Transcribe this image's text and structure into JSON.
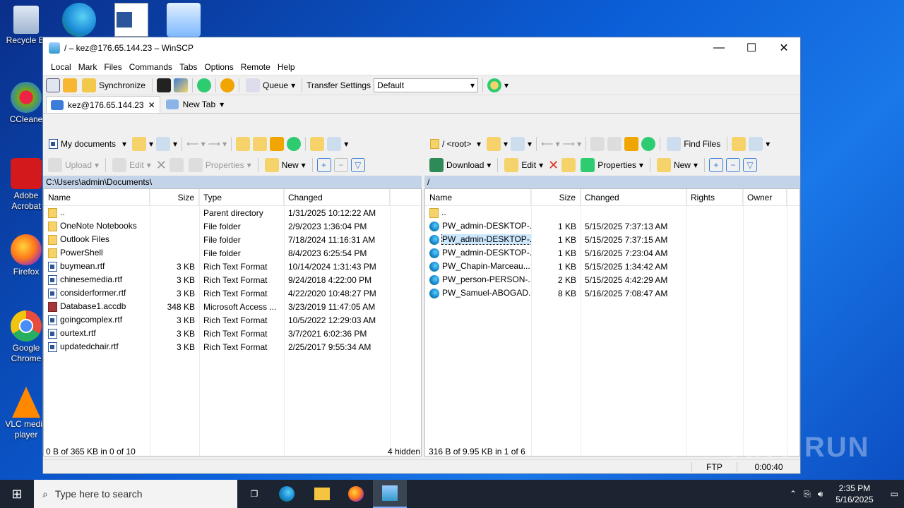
{
  "desktop": {
    "icons": [
      {
        "label": "Recycle Bin",
        "shown": "Recycle Bi"
      },
      {
        "label": "CCleaner",
        "shown": "CCleane"
      },
      {
        "label": "Adobe Acrobat",
        "shown": "Adobe Acrobat"
      },
      {
        "label": "Firefox",
        "shown": "Firefox"
      },
      {
        "label": "Google Chrome",
        "shown": "Google Chrome"
      },
      {
        "label": "VLC media player",
        "shown": "VLC media player"
      }
    ]
  },
  "window": {
    "title": "/ – kez@176.65.144.23 – WinSCP",
    "minimize": "—",
    "maximize": "☐",
    "close": "✕"
  },
  "menu": [
    "Local",
    "Mark",
    "Files",
    "Commands",
    "Tabs",
    "Options",
    "Remote",
    "Help"
  ],
  "toolbar": {
    "synchronize": "Synchronize",
    "queue": "Queue",
    "transfer_settings": "Transfer Settings",
    "transfer_value": "Default"
  },
  "tabs": [
    {
      "label": "kez@176.65.144.23"
    },
    {
      "label": "New Tab"
    }
  ],
  "left": {
    "location": "My documents",
    "upload": "Upload",
    "edit": "Edit",
    "properties": "Properties",
    "new": "New",
    "path": "C:\\Users\\admin\\Documents\\",
    "columns": [
      "Name",
      "Size",
      "Type",
      "Changed"
    ],
    "rows": [
      {
        "icon": "up",
        "name": "..",
        "size": "",
        "type": "Parent directory",
        "changed": "1/31/2025 10:12:22 AM"
      },
      {
        "icon": "folder",
        "name": "OneNote Notebooks",
        "size": "",
        "type": "File folder",
        "changed": "2/9/2023 1:36:04 PM"
      },
      {
        "icon": "folder",
        "name": "Outlook Files",
        "size": "",
        "type": "File folder",
        "changed": "7/18/2024 11:16:31 AM"
      },
      {
        "icon": "folder",
        "name": "PowerShell",
        "size": "",
        "type": "File folder",
        "changed": "8/4/2023 6:25:54 PM"
      },
      {
        "icon": "rtf",
        "name": "buymean.rtf",
        "size": "3 KB",
        "type": "Rich Text Format",
        "changed": "10/14/2024 1:31:43 PM"
      },
      {
        "icon": "rtf",
        "name": "chinesemedia.rtf",
        "size": "3 KB",
        "type": "Rich Text Format",
        "changed": "9/24/2018 4:22:00 PM"
      },
      {
        "icon": "rtf",
        "name": "considerformer.rtf",
        "size": "3 KB",
        "type": "Rich Text Format",
        "changed": "4/22/2020 10:48:27 PM"
      },
      {
        "icon": "acc",
        "name": "Database1.accdb",
        "size": "348 KB",
        "type": "Microsoft Access ...",
        "changed": "3/23/2019 11:47:05 AM"
      },
      {
        "icon": "rtf",
        "name": "goingcomplex.rtf",
        "size": "3 KB",
        "type": "Rich Text Format",
        "changed": "10/5/2022 12:29:03 AM"
      },
      {
        "icon": "rtf",
        "name": "ourtext.rtf",
        "size": "3 KB",
        "type": "Rich Text Format",
        "changed": "3/7/2021 6:02:36 PM"
      },
      {
        "icon": "rtf",
        "name": "updatedchair.rtf",
        "size": "3 KB",
        "type": "Rich Text Format",
        "changed": "2/25/2017 9:55:34 AM"
      }
    ],
    "status": "0 B of 365 KB in 0 of 10",
    "hidden": "4 hidden"
  },
  "right": {
    "location": "/ <root>",
    "find_files": "Find Files",
    "download": "Download",
    "edit": "Edit",
    "properties": "Properties",
    "new": "New",
    "path": "/",
    "columns": [
      "Name",
      "Size",
      "Changed",
      "Rights",
      "Owner"
    ],
    "rows": [
      {
        "icon": "up",
        "name": "..",
        "size": "",
        "changed": ""
      },
      {
        "icon": "edge",
        "name": "PW_admin-DESKTOP-...",
        "size": "1 KB",
        "changed": "5/15/2025 7:37:13 AM"
      },
      {
        "icon": "edge",
        "name": "PW_admin-DESKTOP-...",
        "size": "1 KB",
        "changed": "5/15/2025 7:37:15 AM",
        "selected": true
      },
      {
        "icon": "edge",
        "name": "PW_admin-DESKTOP-...",
        "size": "1 KB",
        "changed": "5/16/2025 7:23:04 AM"
      },
      {
        "icon": "edge",
        "name": "PW_Chapin-Marceau...",
        "size": "1 KB",
        "changed": "5/15/2025 1:34:42 AM"
      },
      {
        "icon": "edge",
        "name": "PW_person-PERSON-...",
        "size": "2 KB",
        "changed": "5/15/2025 4:42:29 AM"
      },
      {
        "icon": "edge",
        "name": "PW_Samuel-ABOGAD...",
        "size": "8 KB",
        "changed": "5/16/2025 7:08:47 AM"
      }
    ],
    "status": "316 B of 9.95 KB in 1 of 6"
  },
  "bottom": {
    "protocol": "FTP",
    "time": "0:00:40"
  },
  "taskbar": {
    "search_placeholder": "Type here to search",
    "time": "2:35 PM",
    "date": "5/16/2025"
  },
  "watermark": "ANY RUN"
}
